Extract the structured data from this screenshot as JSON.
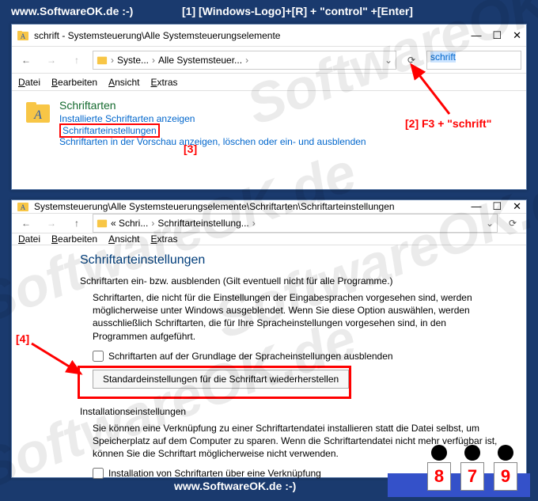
{
  "banner": {
    "site": "www.SoftwareOK.de :-)",
    "step1": "[1] [Windows-Logo]+[R] + \"control\" +[Enter]"
  },
  "annotations": {
    "a2": "[2] F3 + \"schrift\"",
    "a3": "[3]",
    "a4": "[4]"
  },
  "win1": {
    "title": "schrift - Systemsteuerung\\Alle Systemsteuerungselemente",
    "breadcrumb": {
      "p1": "Syste...",
      "p2": "Alle Systemsteuer..."
    },
    "search": "schrift",
    "menu": {
      "datei": "Datei",
      "bearbeiten": "Bearbeiten",
      "ansicht": "Ansicht",
      "extras": "Extras"
    },
    "result": {
      "title": "Schriftarten",
      "link1": "Installierte Schriftarten anzeigen",
      "link2": "Schriftarteinstellungen",
      "desc": "Schriftarten in der Vorschau anzeigen, löschen oder ein- und ausblenden"
    }
  },
  "win2": {
    "title": "Systemsteuerung\\Alle Systemsteuerungselemente\\Schriftarten\\Schriftarteinstellungen",
    "breadcrumb": {
      "p1": "« Schri...",
      "p2": "Schriftarteinstellung..."
    },
    "menu": {
      "datei": "Datei",
      "bearbeiten": "Bearbeiten",
      "ansicht": "Ansicht",
      "extras": "Extras"
    },
    "heading": "Schriftarteinstellungen",
    "sec1_label": "Schriftarten ein- bzw. ausblenden (Gilt eventuell nicht für alle Programme.)",
    "sec1_para": "Schriftarten, die nicht für die Einstellungen der Eingabesprachen vorgesehen sind, werden möglicherweise unter Windows ausgeblendet. Wenn Sie diese Option auswählen, werden ausschließlich Schriftarten, die für Ihre Spracheinstellungen vorgesehen sind, in den Programmen aufgeführt.",
    "cb1": "Schriftarten auf der Grundlage der Spracheinstellungen ausblenden",
    "btn_restore": "Standardeinstellungen für die Schriftart wiederherstellen",
    "sec2_label": "Installationseinstellungen",
    "sec2_para": "Sie können eine Verknüpfung zu einer Schriftartendatei installieren statt die Datei selbst, um Speicherplatz auf dem Computer zu sparen. Wenn die Schriftartendatei nicht mehr verfügbar ist, können Sie die Schriftart möglicherweise nicht verwenden.",
    "cb2": "Installation von Schriftarten über eine Verknüpfung"
  },
  "judges": [
    "8",
    "7",
    "9"
  ],
  "watermark": "SoftwareOK.de"
}
